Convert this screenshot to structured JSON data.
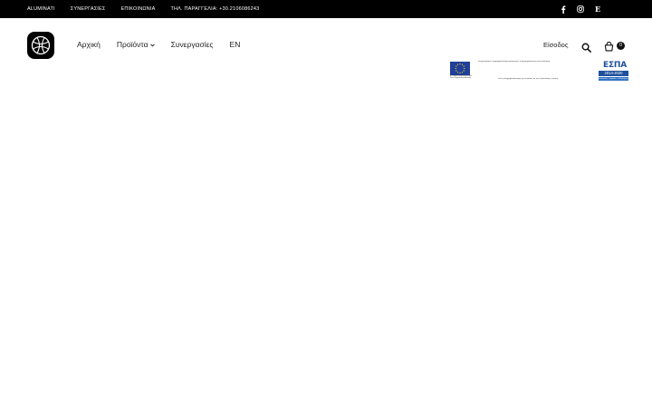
{
  "topbar": {
    "links": [
      "ALUMINATI",
      "ΣΥΝΕΡΓΑΣΙΕΣ",
      "ΕΠΙΚΟΙΝΩΝΙΑ",
      "ΤΗΛ. ΠΑΡΑΓΓΕΛΙΑ: +30.2106086243"
    ],
    "social": [
      "facebook-icon",
      "instagram-icon",
      "etsy-icon"
    ],
    "etsy_glyph": "E"
  },
  "header": {
    "logo": "logo-icon",
    "nav": [
      {
        "label": "Αρχική"
      },
      {
        "label": "Προϊόντα",
        "has_dropdown": true
      },
      {
        "label": "Συνεργασίες"
      },
      {
        "label": "EN"
      }
    ],
    "login_label": "Είσοδος",
    "search": "search-icon",
    "cart": {
      "icon": "cart-icon",
      "count": "0"
    }
  },
  "espa_banner": {
    "eu_caption": "ΕΥΡΩΠΑΪΚΗ ΕΝΩΣΗ Ευρωπαϊκό Ταμείο Περιφερειακής Ανάπτυξης",
    "top_text": "Επιχειρησιακό Πρόγραμμα Ανταγωνιστικότητα, Επιχειρηματικότητα και Καινοτομία",
    "bottom_text": "Με τη συγχρηματοδότηση της Ελλάδας και της Ευρωπαϊκής Ένωσης",
    "logo_word": "ΕΣΠΑ",
    "logo_years": "2014-2020",
    "logo_slogan": "ανάπτυξη - εργασία - αλληλεγγύη"
  },
  "colors": {
    "topbar_bg": "#000000",
    "text": "#222222",
    "espa_blue": "#1d4f9c",
    "eu_blue": "#1f3f9a",
    "eu_stars": "#ffdd00"
  }
}
